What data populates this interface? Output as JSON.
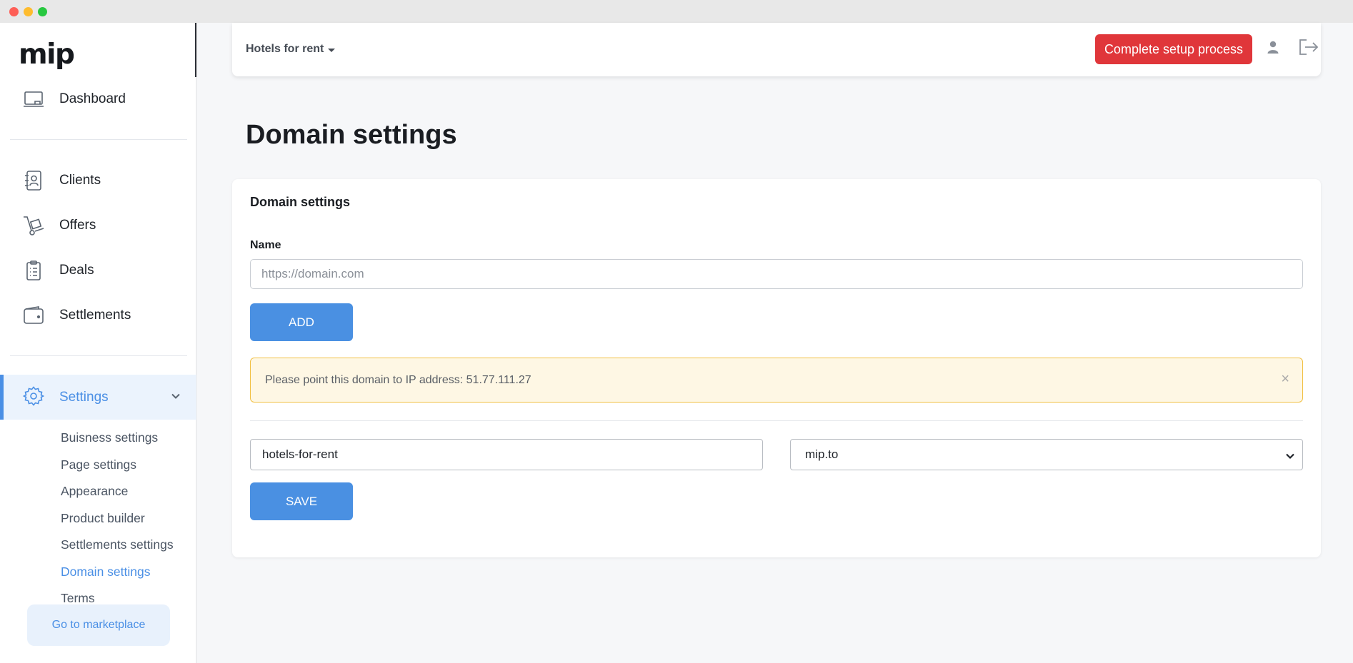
{
  "brand": {
    "logo_text": "mip"
  },
  "sidebar": {
    "primary": [
      {
        "label": "Dashboard",
        "icon": "laptop-icon"
      }
    ],
    "main": [
      {
        "label": "Clients",
        "icon": "contact-book-icon"
      },
      {
        "label": "Offers",
        "icon": "hand-truck-icon"
      },
      {
        "label": "Deals",
        "icon": "clipboard-list-icon"
      },
      {
        "label": "Settlements",
        "icon": "wallet-icon"
      }
    ],
    "settings": {
      "label": "Settings",
      "icon": "gear-icon",
      "expanded": true,
      "subitems": [
        {
          "label": "Buisness settings"
        },
        {
          "label": "Page settings"
        },
        {
          "label": "Appearance"
        },
        {
          "label": "Product builder"
        },
        {
          "label": "Settlements settings"
        },
        {
          "label": "Domain settings",
          "active": true
        },
        {
          "label": "Terms"
        }
      ]
    },
    "marketplace_label": "Go to marketplace"
  },
  "topbar": {
    "workspace_label": "Hotels for rent",
    "setup_button_label": "Complete setup process",
    "setup_button_color": "#e0363a"
  },
  "page": {
    "title": "Domain settings"
  },
  "card": {
    "title": "Domain settings",
    "name_label": "Name",
    "name_placeholder": "https://domain.com",
    "name_value": "",
    "add_label": "ADD",
    "alert_text": "Please point this domain to IP address: 51.77.111.27",
    "alert_close": "×",
    "subdomain_value": "hotels-for-rent",
    "domain_select_value": "mip.to",
    "save_label": "SAVE"
  },
  "colors": {
    "accent": "#4a90e2",
    "danger": "#e0363a",
    "alert_bg": "#fef7e4",
    "alert_border": "#f1c043"
  }
}
